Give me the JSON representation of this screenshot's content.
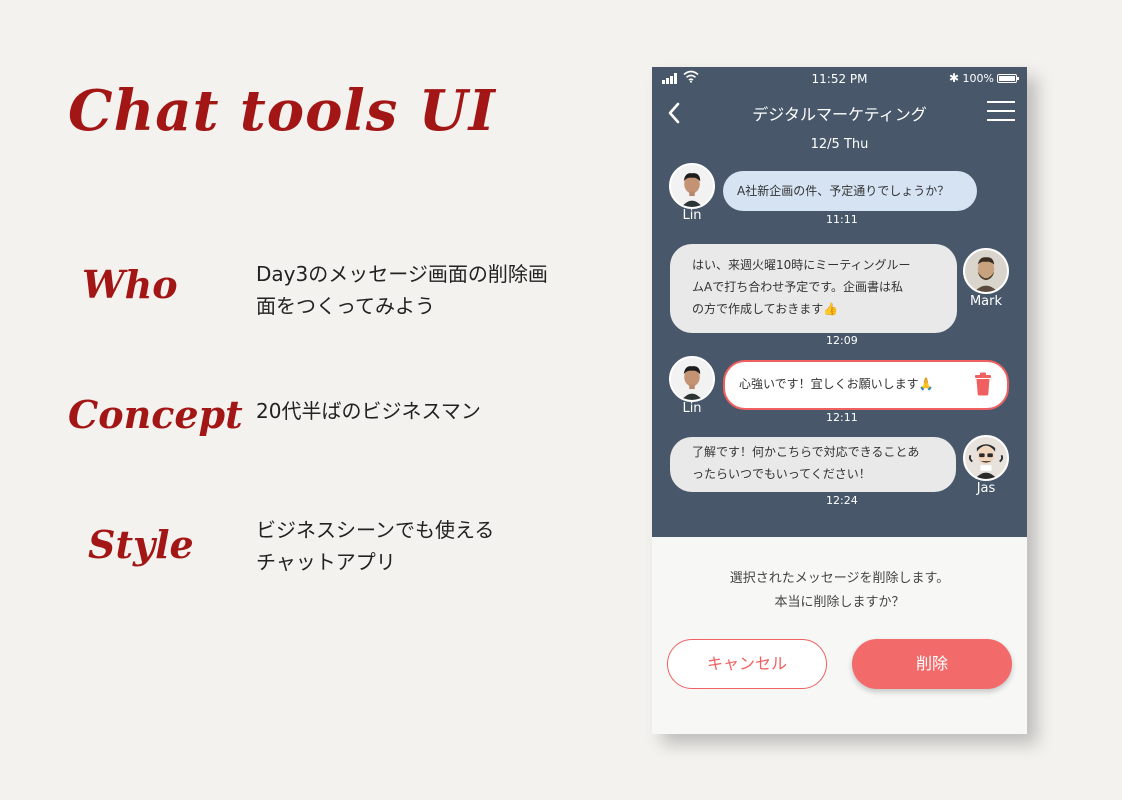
{
  "intro": {
    "title": "Chat tools UI",
    "who_label": "Who",
    "who_text_line1": "Day3のメッセージ画面の削除画",
    "who_text_line2": "面をつくってみよう",
    "concept_label": "Concept",
    "concept_text": "20代半ばのビジネスマン",
    "style_label": "Style",
    "style_text_line1": "ビジネスシーンでも使える",
    "style_text_line2": "チャットアプリ"
  },
  "status_bar": {
    "time": "11:52 PM",
    "battery": "100%",
    "bluetooth_icon": "✱"
  },
  "header": {
    "title": "デジタルマーケティング"
  },
  "chat": {
    "date": "12/5 Thu",
    "messages": [
      {
        "sender": "Lin",
        "line1": "A社新企画の件、予定通りでしょうか？",
        "time": "11:11"
      },
      {
        "sender": "Mark",
        "line1": "はい、来週火曜10時にミーティングルー",
        "line2": "ムAで打ち合わせ予定です。企画書は私",
        "line3": "の方で作成しておきます👍",
        "time": "12:09"
      },
      {
        "sender": "Lin",
        "line1": "心強いです！宜しくお願いします🙏",
        "time": "12:11"
      },
      {
        "sender": "Jas",
        "line1": "了解です！何かこちらで対応できることあ",
        "line2": "ったらいつでもいってください！",
        "time": "12:24"
      }
    ]
  },
  "delete_sheet": {
    "line1": "選択されたメッセージを削除します。",
    "line2": "本当に削除しますか？",
    "cancel_label": "キャンセル",
    "delete_label": "削除"
  },
  "colors": {
    "accent": "#f26a6a",
    "title_red": "#a31616",
    "chat_bg": "#48586a",
    "page_bg": "#f3f2ee"
  }
}
